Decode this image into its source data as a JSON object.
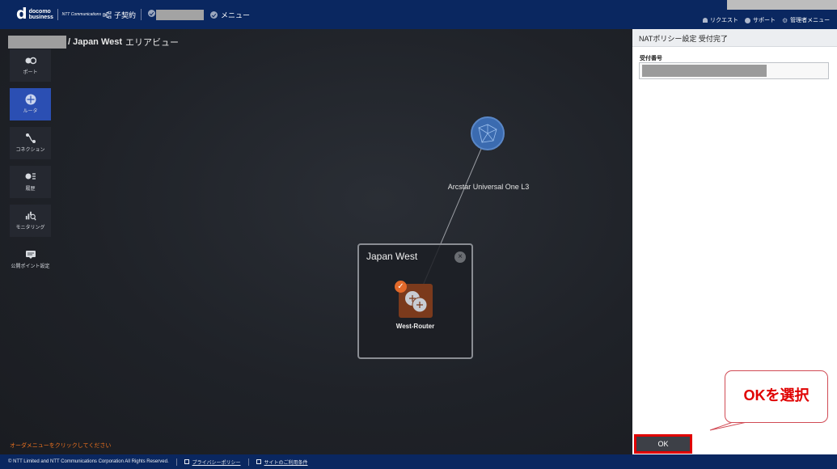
{
  "header": {
    "logo_mark": "d",
    "logo_text": "docomo business",
    "ntt_text": "NTT Communications",
    "contract_label": "子契約",
    "menu_label": "メニュー",
    "request_label": "リクエスト",
    "support_label": "サポート",
    "admin_label": "管理者メニュー"
  },
  "breadcrumb": {
    "area": "/ Japan West",
    "view": "エリアビュー"
  },
  "sidebar": {
    "items": [
      {
        "label": "ポート",
        "icon": "port-icon",
        "active": false
      },
      {
        "label": "ルータ",
        "icon": "router-icon",
        "active": true
      },
      {
        "label": "コネクション",
        "icon": "connection-icon",
        "active": false
      },
      {
        "label": "履歴",
        "icon": "history-icon",
        "active": false
      },
      {
        "label": "モニタリング",
        "icon": "monitoring-icon",
        "active": false
      },
      {
        "label": "公開ポイント設定",
        "icon": "public-point-icon",
        "active": false
      }
    ]
  },
  "network": {
    "label": "Arcstar Universal One L3"
  },
  "area": {
    "title": "Japan West",
    "close": "×",
    "router_label": "West-Router"
  },
  "hint": "オーダメニューをクリックしてください",
  "panel": {
    "title": "NATポリシー設定 受付完了",
    "field_label": "受付番号",
    "ok_label": "OK"
  },
  "callout": "OKを選択",
  "footer": {
    "copyright": "© NTT Limited and NTT Communications Corporation All Rights Reserved.",
    "privacy": "プライバシーポリシー",
    "terms": "サイトのご利用条件"
  },
  "colors": {
    "header_bg": "#0a2760",
    "accent_active": "#2b4fb3",
    "router_bg": "#7b3a1c",
    "highlight": "#e00000",
    "hint": "#f0731f"
  }
}
